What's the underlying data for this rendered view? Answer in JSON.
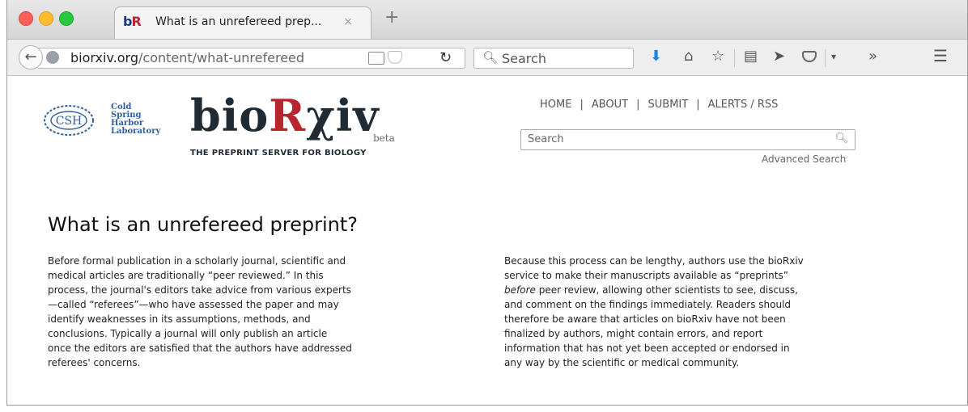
{
  "browser": {
    "tab": {
      "favicon_b": "b",
      "favicon_r": "R",
      "title": "What is an unrefereed prep...",
      "close": "×"
    },
    "new_tab": "+",
    "back": "←",
    "url_host": "biorxiv.org",
    "url_path": "/content/what-unrefereed",
    "reload": "↻",
    "search_placeholder": "Search",
    "toolbar_icons": [
      "download-icon",
      "home-icon",
      "bookmark-star-icon",
      "reading-list-icon",
      "send-icon",
      "pocket-icon",
      "overflow-chevron-icon",
      "menu-icon"
    ]
  },
  "site": {
    "csh_lines": [
      "Cold",
      "Spring",
      "Harbor",
      "Laboratory"
    ],
    "csh_mark": "CSH",
    "logo_pre": "bio",
    "logo_r": "R",
    "logo_post": "χiv",
    "beta": "beta",
    "tagline": "THE PREPRINT SERVER FOR BIOLOGY",
    "nav": {
      "home": "HOME",
      "about": "ABOUT",
      "submit": "SUBMIT",
      "alerts": "ALERTS / RSS",
      "sep": "|"
    },
    "search_placeholder": "Search",
    "advanced_search": "Advanced Search"
  },
  "article": {
    "heading": "What is an unrefereed preprint?",
    "left_lines": [
      "Before formal publication in a scholarly journal, scientific and",
      "medical articles are traditionally “peer reviewed.” In this",
      "process, the journal's editors take advice from various experts",
      "—called “referees”—who have assessed the paper and may",
      "identify weaknesses in its assumptions, methods, and",
      "conclusions. Typically a journal will only publish an article",
      "once the editors are satisfied that the authors have addressed",
      "referees' concerns."
    ],
    "right_lines": [
      "Because this process can be lengthy, authors use the bioRxiv",
      "service to make their manuscripts available as “preprints”",
      "peer review, allowing other scientists to see, discuss,",
      "and comment on the findings immediately. Readers should",
      "therefore be aware that articles on bioRxiv have not been",
      "finalized by authors, might contain errors, and report",
      "information that has not yet been accepted or endorsed in",
      "any way by the scientific or medical community."
    ],
    "right_italic_word": "before"
  },
  "colors": {
    "brand_red": "#b7262f",
    "brand_dark": "#1f2a33",
    "csh_blue": "#2f5fa0",
    "download_blue": "#1b84e8"
  }
}
